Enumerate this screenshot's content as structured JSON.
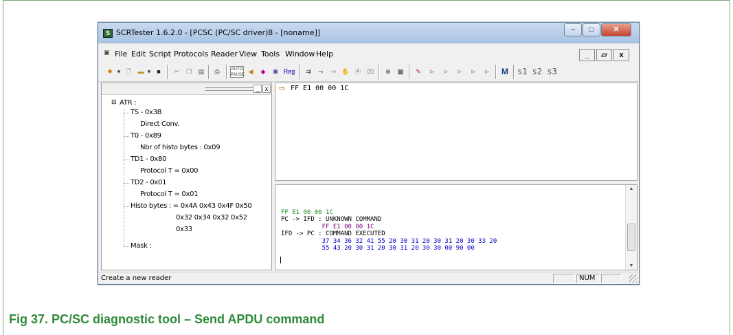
{
  "window": {
    "title": "SCRTester 1.6.2.0 - [PCSC (PC/SC driver)8 - [noname]]",
    "app_icon": "scr-icon",
    "controls": {
      "minimize": "–",
      "maximize": "□",
      "close": "✕"
    }
  },
  "menu": {
    "items": [
      "File",
      "Edit",
      "Script",
      "Protocols",
      "Reader",
      "View",
      "Tools",
      "Window",
      "Help"
    ],
    "mdi": {
      "minimize": "_",
      "restore": "▱",
      "close": "x"
    }
  },
  "toolbar": {
    "buttons": [
      "new",
      "new-dropdown",
      "open",
      "save",
      "cut",
      "copy",
      "paste",
      "print",
      "auto-pause",
      "step",
      "erase",
      "auto-tote",
      "reg",
      "send",
      "run",
      "step-out",
      "hand",
      "breakpoint",
      "clear",
      "target",
      "grid",
      "marker",
      "play1",
      "play2",
      "play3",
      "play4",
      "play5"
    ],
    "auto_label": "AUTO PAUSE",
    "reg_label": "Reg",
    "m_label": "M",
    "script_tabs": "s1 s2 s3"
  },
  "tree": {
    "root": "ATR :",
    "nodes": [
      {
        "label": "TS  - 0x3B"
      },
      {
        "label": "Direct Conv."
      },
      {
        "label": "T0   - 0x89"
      },
      {
        "label": "Nbr of histo bytes : 0x09"
      },
      {
        "label": "TD1 - 0x80"
      },
      {
        "label": "Protocol T = 0x00"
      },
      {
        "label": "TD2 - 0x01"
      },
      {
        "label": "Protocol T = 0x01"
      },
      {
        "label": "Histo bytes : = 0x4A 0x43 0x4F 0x50"
      },
      {
        "label": "0x32 0x34 0x32 0x52"
      },
      {
        "label": "0x33"
      }
    ],
    "mask": "Mask :",
    "collapse_symbol": "⊟"
  },
  "command": {
    "text": "FF E1 00 00 1C"
  },
  "log": {
    "line1": "FF E1 00 00 1C",
    "line2": "PC -> IFD : UNKNOWN COMMAND",
    "line3": "           FF E1 00 00 1C",
    "line4": "IFD -> PC : COMMAND EXECUTED",
    "line5": "           37 34 36 32 41 55 20 30 31 20 30 31 20 30 33 20",
    "line6": "           55 43 20 30 31 20 30 31 20 30 30 00 90 00",
    "colors": {
      "sent": "#228b22",
      "apdu": "#800080",
      "response": "#0000cc"
    }
  },
  "status": {
    "text": "Create a new reader",
    "num": "NUM"
  },
  "caption": "Fig 37.    PC/SC diagnostic tool – Send APDU command"
}
